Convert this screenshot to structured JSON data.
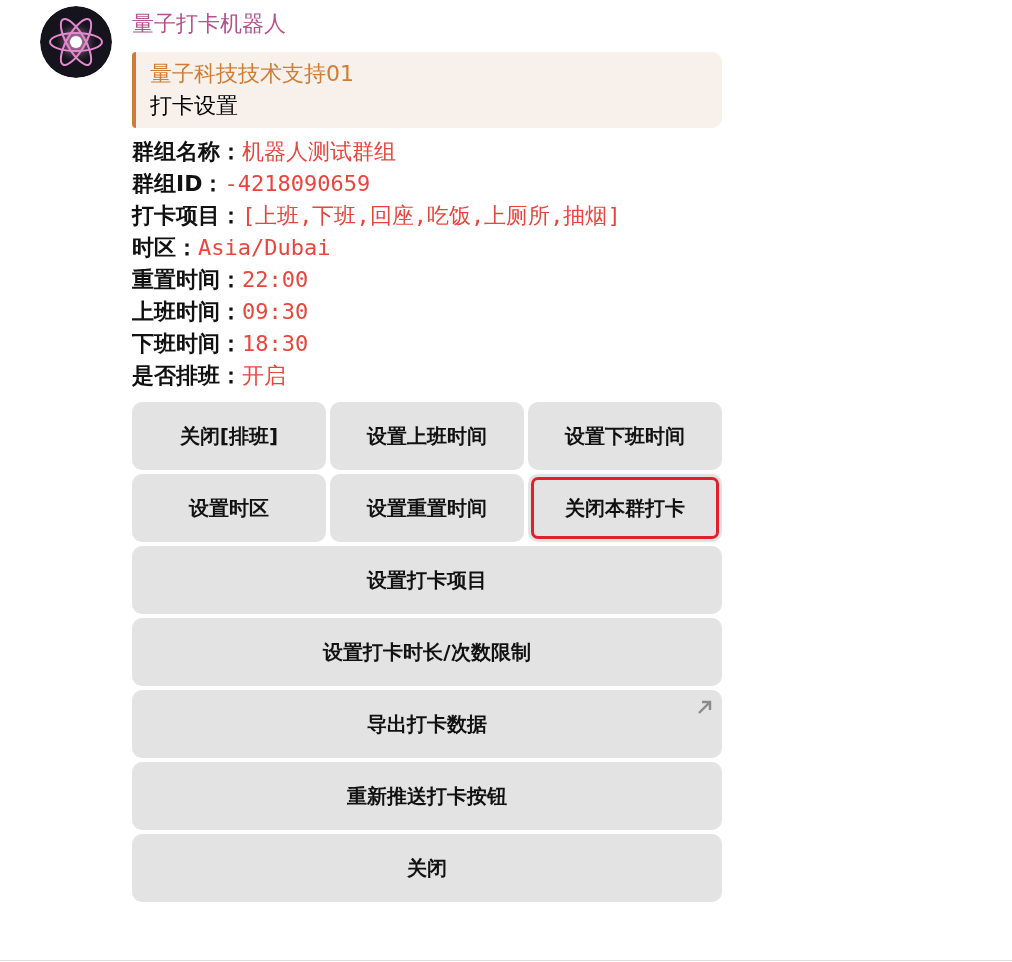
{
  "message": {
    "sender": "量子打卡机器人",
    "reply": {
      "author": "量子科技技术支持01",
      "text": "打卡设置"
    },
    "fields": [
      {
        "label": "群组名称：",
        "value": "机器人测试群组"
      },
      {
        "label": "群组ID：",
        "value": "-4218090659"
      },
      {
        "label": "打卡项目：",
        "value": "[上班,下班,回座,吃饭,上厕所,抽烟]"
      },
      {
        "label": "时区：",
        "value": "Asia/Dubai"
      },
      {
        "label": "重置时间：",
        "value": "22:00"
      },
      {
        "label": "上班时间：",
        "value": "09:30"
      },
      {
        "label": "下班时间：",
        "value": "18:30"
      },
      {
        "label": "是否排班：",
        "value": "开启"
      }
    ],
    "keyboard": [
      [
        {
          "label": "关闭[排班]",
          "kind": "callback",
          "highlighted": false
        },
        {
          "label": "设置上班时间",
          "kind": "callback",
          "highlighted": false
        },
        {
          "label": "设置下班时间",
          "kind": "callback",
          "highlighted": false
        }
      ],
      [
        {
          "label": "设置时区",
          "kind": "callback",
          "highlighted": false
        },
        {
          "label": "设置重置时间",
          "kind": "callback",
          "highlighted": false
        },
        {
          "label": "关闭本群打卡",
          "kind": "callback",
          "highlighted": true
        }
      ],
      [
        {
          "label": "设置打卡项目",
          "kind": "callback",
          "highlighted": false
        }
      ],
      [
        {
          "label": "设置打卡时长/次数限制",
          "kind": "callback",
          "highlighted": false
        }
      ],
      [
        {
          "label": "导出打卡数据",
          "kind": "url",
          "highlighted": false
        }
      ],
      [
        {
          "label": "重新推送打卡按钮",
          "kind": "callback",
          "highlighted": false
        }
      ],
      [
        {
          "label": "关闭",
          "kind": "callback",
          "highlighted": false
        }
      ]
    ]
  }
}
